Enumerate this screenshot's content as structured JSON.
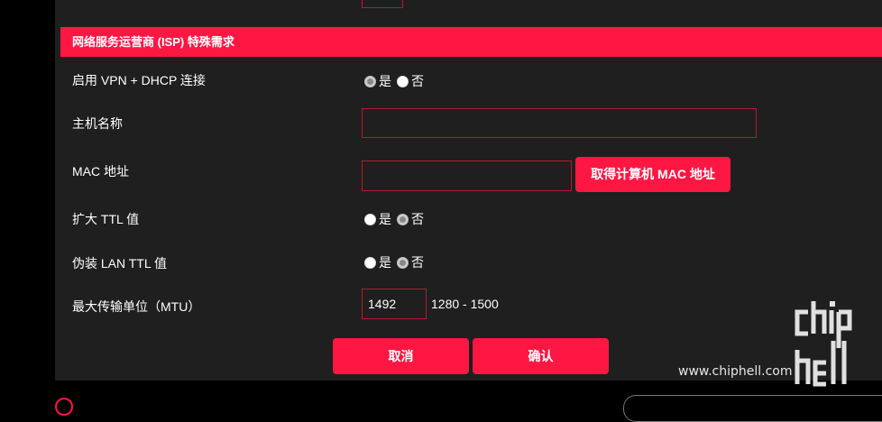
{
  "section": {
    "title": "网络服务运营商 (ISP) 特殊需求"
  },
  "rows": {
    "vpn_dhcp": {
      "label": "启用 VPN + DHCP 连接",
      "yes": "是",
      "no": "否",
      "selected": "yes"
    },
    "hostname": {
      "label": "主机名称",
      "value": ""
    },
    "mac": {
      "label": "MAC 地址",
      "value": "",
      "button": "取得计算机 MAC 地址"
    },
    "ttl_extend": {
      "label": "扩大 TTL 值",
      "yes": "是",
      "no": "否",
      "selected": "no"
    },
    "lan_ttl": {
      "label": "伪装 LAN TTL 值",
      "yes": "是",
      "no": "否",
      "selected": "no"
    },
    "mtu": {
      "label": "最大传输单位（MTU）",
      "value": "1492",
      "range": "1280 - 1500"
    }
  },
  "actions": {
    "cancel": "取消",
    "confirm": "确认"
  },
  "watermark": {
    "url": "www.chiphell.com",
    "logo": "chiphell"
  },
  "colors": {
    "accent": "#ff1744",
    "panel": "#1f1f1f",
    "background": "#000000"
  }
}
